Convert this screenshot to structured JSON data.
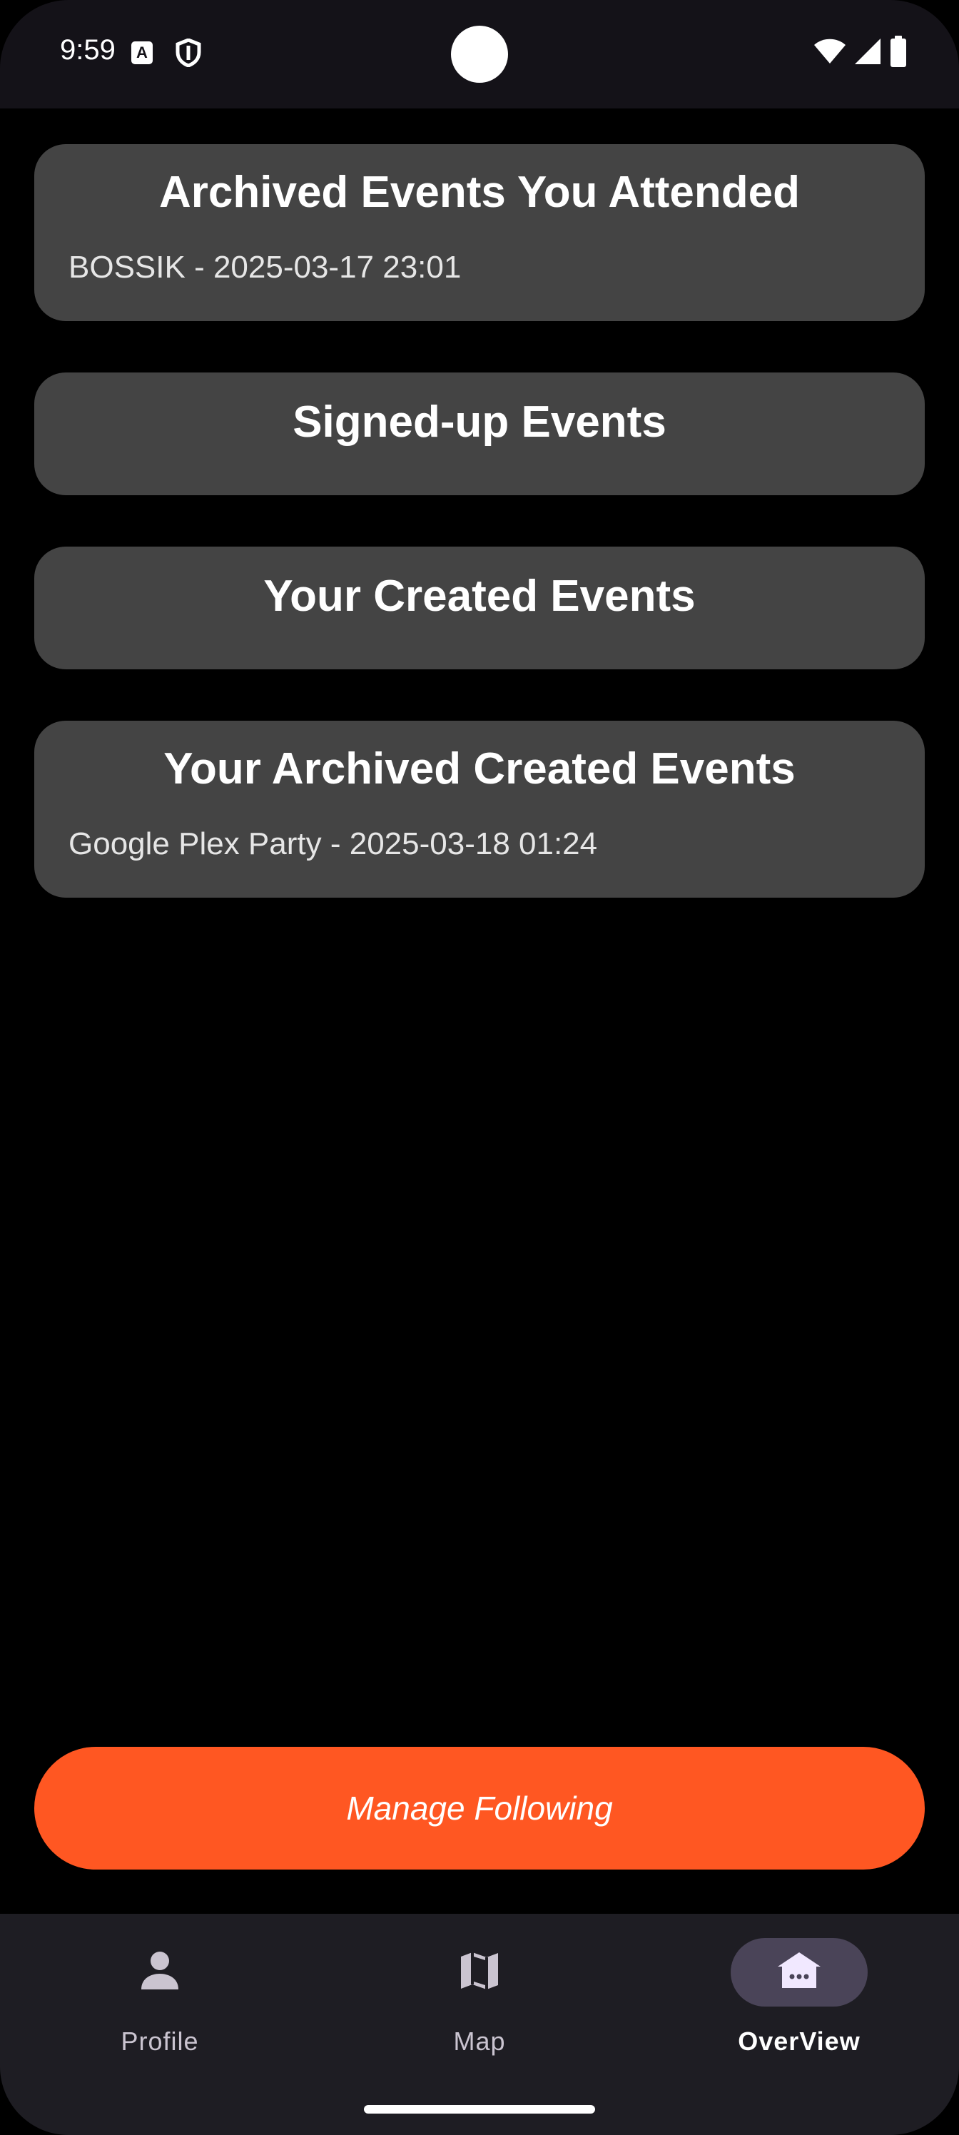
{
  "status_bar": {
    "time": "9:59",
    "notification_icon_letter": "A"
  },
  "cards": [
    {
      "title": "Archived Events You Attended",
      "items": [
        "BOSSIK - 2025-03-17 23:01"
      ]
    },
    {
      "title": "Signed-up Events",
      "items": []
    },
    {
      "title": "Your Created Events",
      "items": []
    },
    {
      "title": "Your Archived Created Events",
      "items": [
        "Google Plex Party - 2025-03-18 01:24"
      ]
    }
  ],
  "manage_button": {
    "label": "Manage Following"
  },
  "bottom_nav": {
    "items": [
      {
        "label": "Profile",
        "icon": "person-icon",
        "active": false
      },
      {
        "label": "Map",
        "icon": "map-icon",
        "active": false
      },
      {
        "label": "OverView",
        "icon": "home-icon",
        "active": true
      }
    ]
  },
  "colors": {
    "accent": "#ff5722",
    "card_bg": "#444444",
    "nav_bg": "#1e1d23",
    "nav_active_pill": "#4a4458"
  }
}
